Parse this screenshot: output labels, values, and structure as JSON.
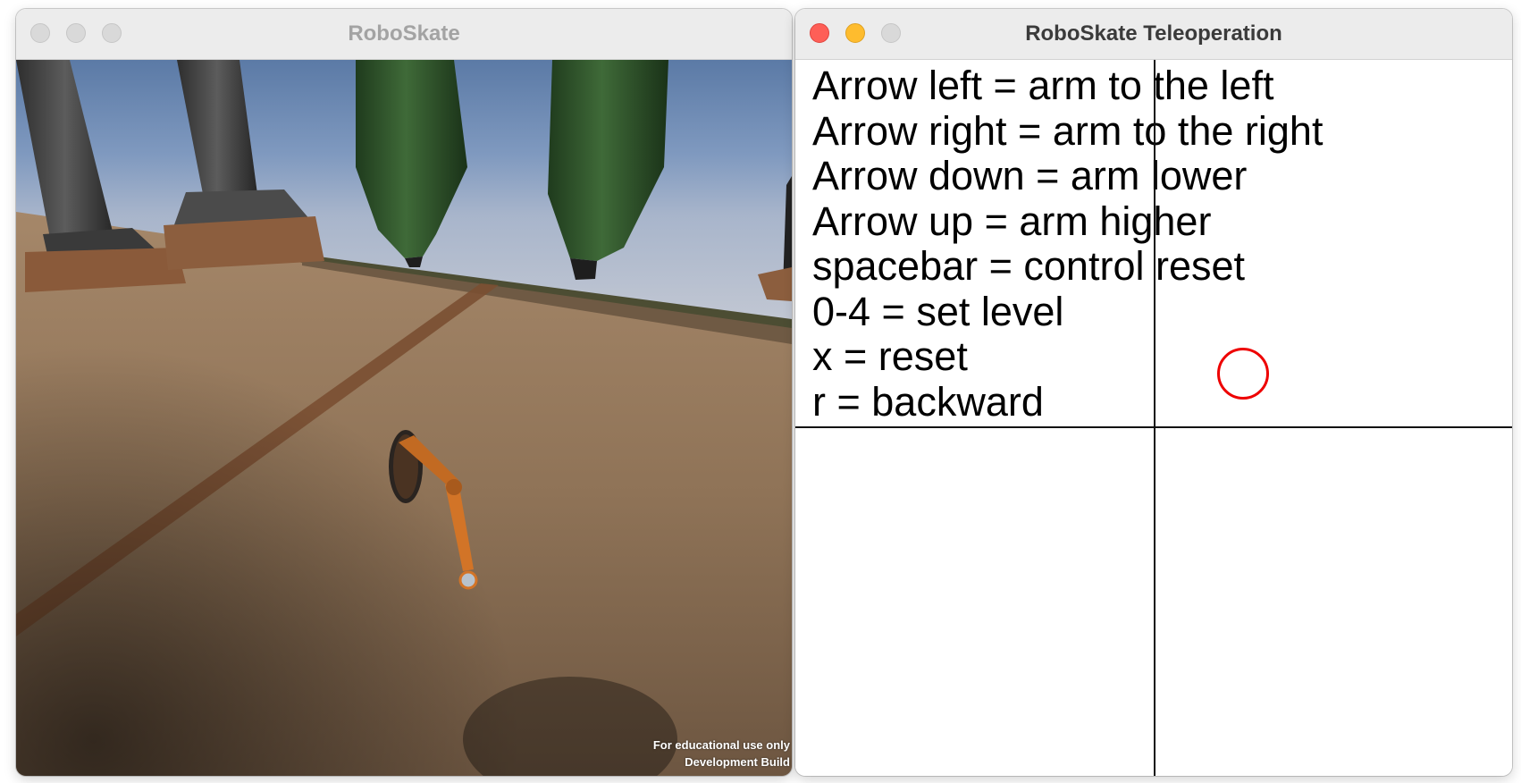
{
  "windows": {
    "game": {
      "title": "RoboSkate",
      "watermark": {
        "line1": "For educational use only",
        "line2": "Development Build"
      }
    },
    "teleop": {
      "title": "RoboSkate Teleoperation",
      "instructions": [
        "Arrow left = arm to the left",
        "Arrow right = arm to the right",
        "Arrow down = arm lower",
        "Arrow up = arm higher",
        "spacebar = control reset",
        "0-4 = set level",
        "x = reset",
        "r = backward"
      ],
      "colors": {
        "cursor": "#ee0000",
        "axes": "#111111",
        "background": "#ffffff"
      }
    }
  },
  "icons": {
    "close": "close-icon",
    "minimize": "minimize-icon",
    "zoom": "zoom-icon"
  }
}
